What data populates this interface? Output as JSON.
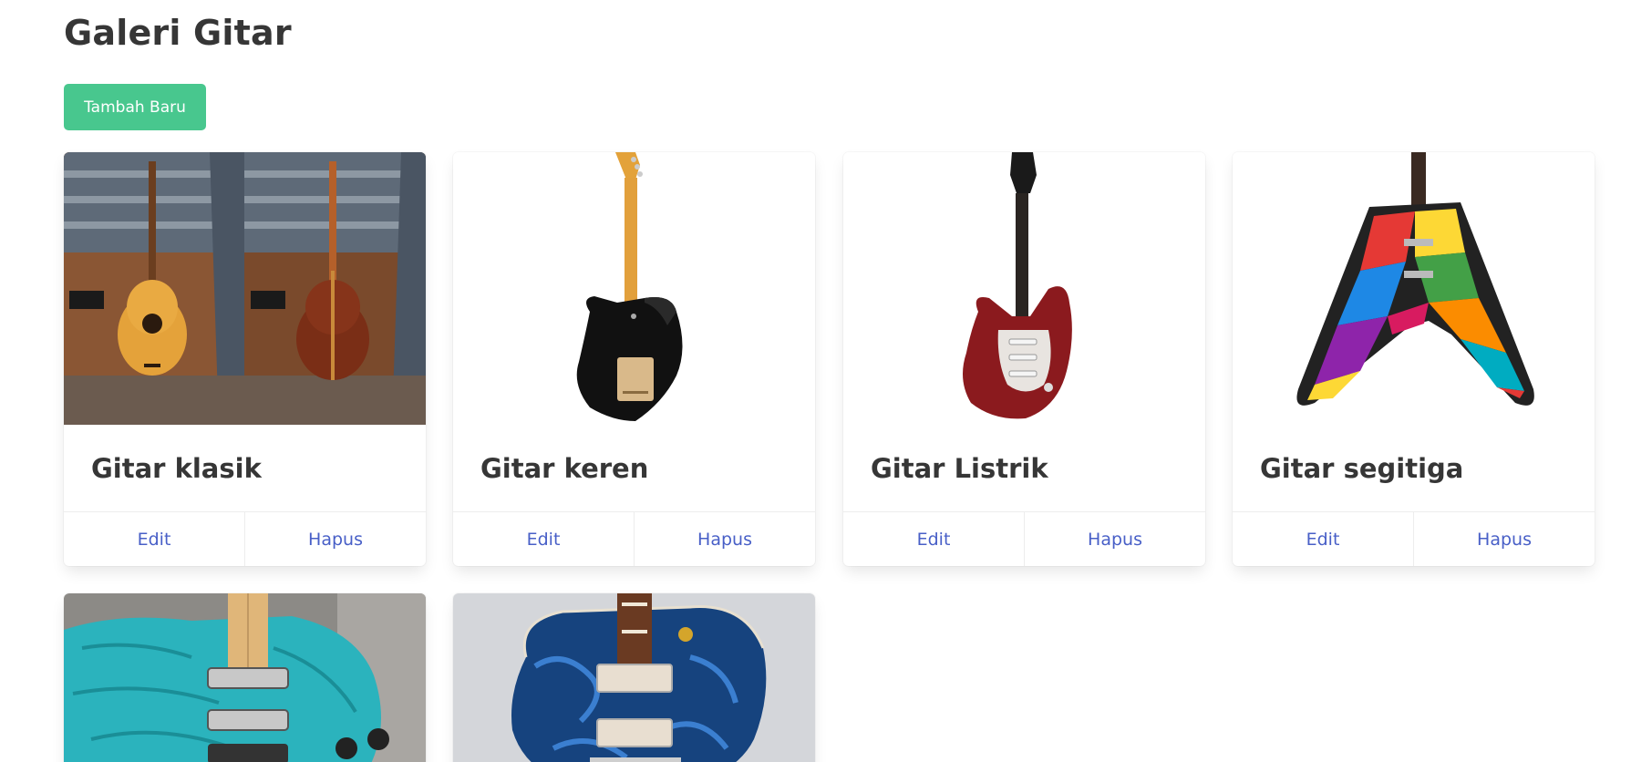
{
  "header": {
    "title": "Galeri Gitar",
    "add_button_label": "Tambah Baru"
  },
  "cards": [
    {
      "title": "Gitar klasik",
      "edit_label": "Edit",
      "delete_label": "Hapus",
      "image": "acoustic-guitar-front-and-back-photo"
    },
    {
      "title": "Gitar keren",
      "edit_label": "Edit",
      "delete_label": "Hapus",
      "image": "black-stratocaster-back-photo"
    },
    {
      "title": "Gitar Listrik",
      "edit_label": "Edit",
      "delete_label": "Hapus",
      "image": "red-electric-guitar-photo"
    },
    {
      "title": "Gitar segitiga",
      "edit_label": "Edit",
      "delete_label": "Hapus",
      "image": "colorful-flying-v-guitar-photo"
    }
  ],
  "partial_cards": [
    {
      "image": "turquoise-electric-guitar-photo"
    },
    {
      "image": "blue-quilted-les-paul-photo"
    }
  ],
  "colors": {
    "primary_button": "#48c78e",
    "link": "#485fc7",
    "text": "#363636"
  }
}
